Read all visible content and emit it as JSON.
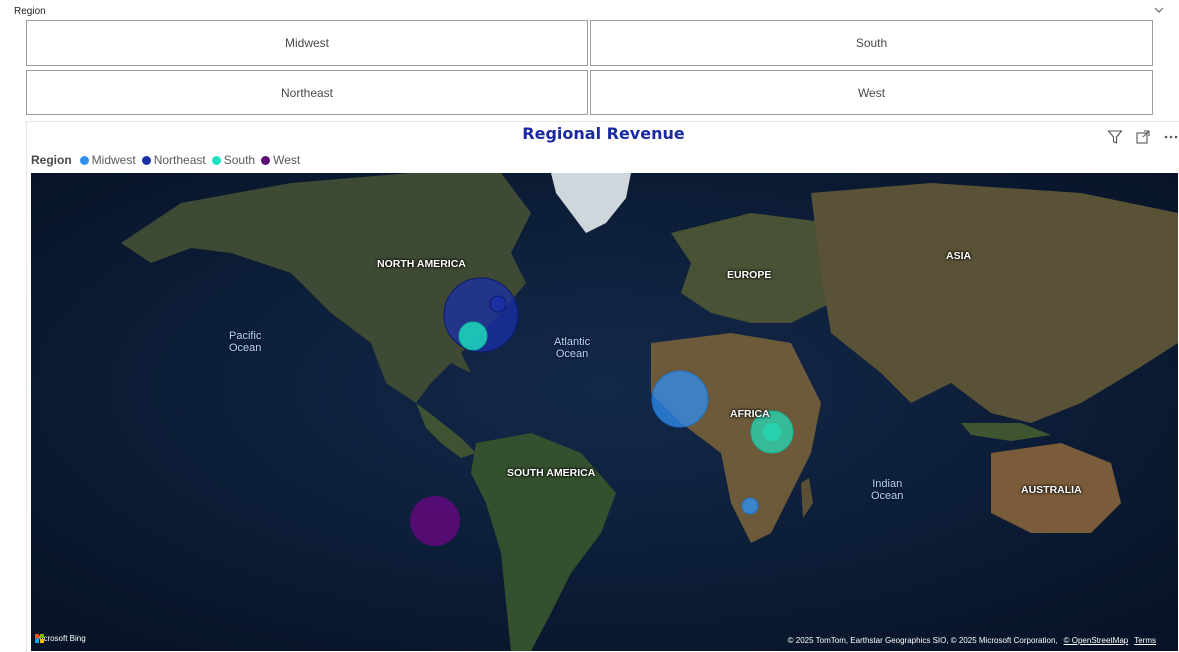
{
  "slicer": {
    "title": "Region",
    "options": [
      "Midwest",
      "South",
      "Northeast",
      "West"
    ]
  },
  "visual": {
    "title": "Regional Revenue",
    "legend_title": "Region",
    "legend_items": [
      {
        "label": "Midwest",
        "color": "#2f8ef0"
      },
      {
        "label": "Northeast",
        "color": "#1a2fa8"
      },
      {
        "label": "South",
        "color": "#1fe3c0"
      },
      {
        "label": "West",
        "color": "#5c0a7a"
      }
    ],
    "header_icons": [
      "filter-icon",
      "focus-mode-icon",
      "more-options-icon"
    ]
  },
  "map": {
    "labels": {
      "north_america": "NORTH AMERICA",
      "south_america": "SOUTH AMERICA",
      "europe": "EUROPE",
      "asia": "ASIA",
      "africa": "AFRICA",
      "australia": "AUSTRALIA"
    },
    "oceans": {
      "pacific_1": "Pacific",
      "pacific_2": "Ocean",
      "atlantic_1": "Atlantic",
      "atlantic_2": "Ocean",
      "indian_1": "Indian",
      "indian_2": "Ocean"
    },
    "bing": "Microsoft Bing",
    "attribution": "© 2025 TomTom, Earthstar Geographics SIO, © 2025 Microsoft Corporation,",
    "osm_link": "© OpenStreetMap",
    "terms": "Terms",
    "bubble_colors": {
      "midwest": "#2f8ef0",
      "northeast": "#1a2fa8",
      "south": "#1fe3c0",
      "west": "#5c0a7a"
    }
  }
}
